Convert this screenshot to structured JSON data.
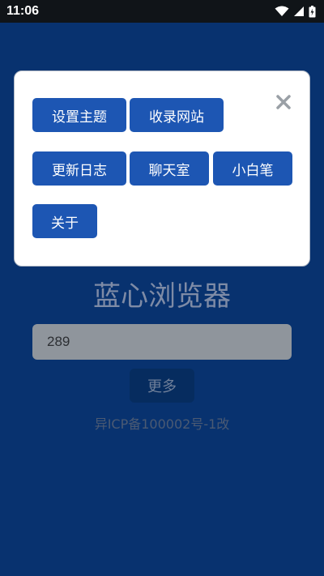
{
  "status_bar": {
    "time": "11:06",
    "icons": [
      "wifi-icon",
      "signal-icon",
      "battery-icon"
    ]
  },
  "app": {
    "title": "蓝心浏览器",
    "input_value": "289",
    "more_label": "更多",
    "footer": "异ICP备100002号-1改"
  },
  "dialog": {
    "buttons": [
      "设置主题",
      "收录网站",
      "更新日志",
      "聊天室",
      "小白笔",
      "关于"
    ],
    "close_icon": "close-icon"
  },
  "colors": {
    "background": "#08326f",
    "button_blue": "#1d56b3",
    "status_bar": "#101418"
  }
}
